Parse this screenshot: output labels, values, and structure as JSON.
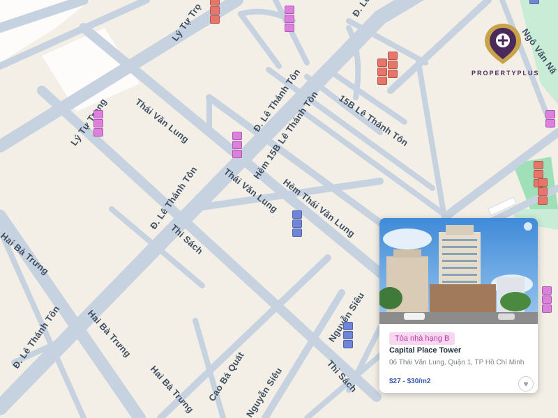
{
  "map": {
    "road_labels": [
      "Lý Tự Trọ",
      "Lý Tự Trọng",
      "Đ. Lê",
      "Đ. Lê Thánh Tôn",
      "15B Lê Thánh Tôn",
      "Hẻm 15B Lê Thánh Tôn",
      "Thái Văn Lung",
      "Thái Văn Lung",
      "Hẻm Thái Văn Lung",
      "Đ. Lê Thánh Tôn",
      "Thi Sách",
      "Hai Bà Trưng",
      "Đ. Lê Thánh Tôn",
      "Hai Bà Trưng",
      "Hai Bà Trưng",
      "Cao Bá Quát",
      "Nguyễn Siêu",
      "Nguyễn Siêu",
      "Thi Sách",
      "Ngô Văn Nă"
    ],
    "marker_colors": {
      "red": "#e8756a",
      "pink": "#de7fe0",
      "blue": "#6f86d8"
    }
  },
  "brand": {
    "name": "PROPERTYPLUS",
    "logo_icon": "location-pin-plus-icon",
    "accent": "#4a2a5a",
    "gold": "#c9a24a"
  },
  "card": {
    "badge": "Tòa nhà hạng B",
    "title": "Capital Place Tower",
    "address": "06 Thái Văn Lung, Quận 1, TP Hồ Chí Minh",
    "price": "$27 - $30/m2",
    "favorite_icon": "heart-icon"
  }
}
